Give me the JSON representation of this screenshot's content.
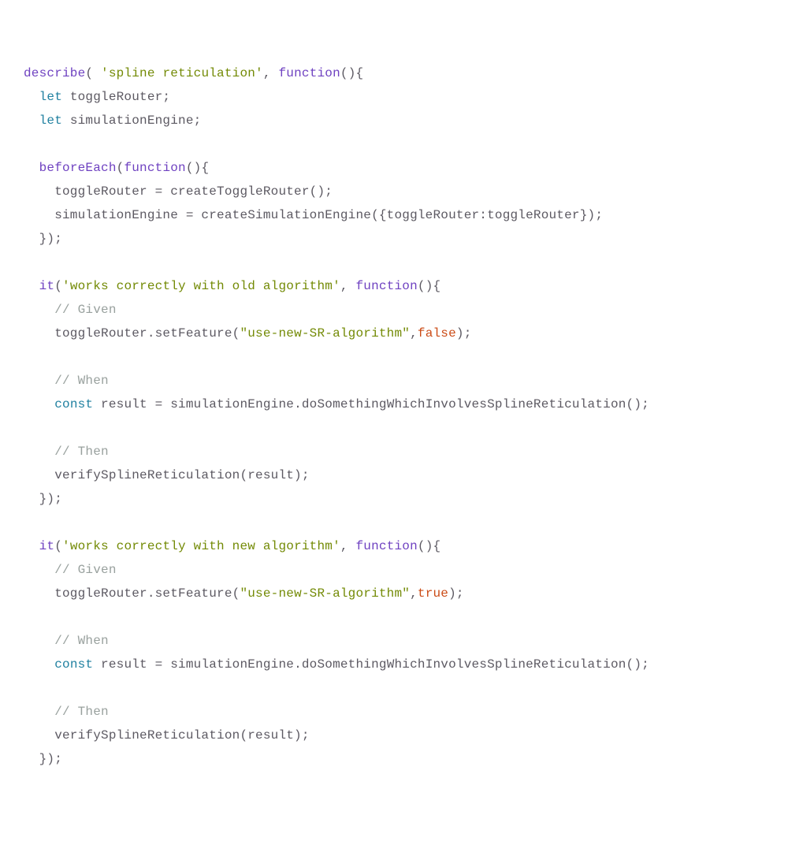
{
  "tokens": [
    {
      "id": "l1t1",
      "cls": "fn"
    },
    {
      "id": "l1t2",
      "cls": "id"
    },
    {
      "id": "l1t3",
      "cls": "str"
    },
    {
      "id": "l1t4",
      "cls": "id"
    },
    {
      "id": "l1t5",
      "cls": "fn"
    },
    {
      "id": "l1t6",
      "cls": "id"
    },
    {
      "id": "l2t1",
      "cls": "id"
    },
    {
      "id": "l2t2",
      "cls": "kw"
    },
    {
      "id": "l2t3",
      "cls": "id"
    },
    {
      "id": "l3t1",
      "cls": "id"
    },
    {
      "id": "l3t2",
      "cls": "kw"
    },
    {
      "id": "l3t3",
      "cls": "id"
    },
    {
      "id": "l4",
      "cls": "id"
    },
    {
      "id": "l5t1",
      "cls": "id"
    },
    {
      "id": "l5t2",
      "cls": "fn"
    },
    {
      "id": "l5t3",
      "cls": "id"
    },
    {
      "id": "l5t4",
      "cls": "fn"
    },
    {
      "id": "l5t5",
      "cls": "id"
    },
    {
      "id": "l6",
      "cls": "id"
    },
    {
      "id": "l7",
      "cls": "id"
    },
    {
      "id": "l8",
      "cls": "id"
    },
    {
      "id": "l9",
      "cls": "id"
    },
    {
      "id": "l10t1",
      "cls": "id"
    },
    {
      "id": "l10t2",
      "cls": "fn"
    },
    {
      "id": "l10t3",
      "cls": "id"
    },
    {
      "id": "l10t4",
      "cls": "str"
    },
    {
      "id": "l10t5",
      "cls": "id"
    },
    {
      "id": "l10t6",
      "cls": "fn"
    },
    {
      "id": "l10t7",
      "cls": "id"
    },
    {
      "id": "l11t1",
      "cls": "id"
    },
    {
      "id": "l11t2",
      "cls": "com"
    },
    {
      "id": "l12t1",
      "cls": "id"
    },
    {
      "id": "l12t2",
      "cls": "str"
    },
    {
      "id": "l12t3",
      "cls": "id"
    },
    {
      "id": "l12t4",
      "cls": "lit"
    },
    {
      "id": "l12t5",
      "cls": "id"
    },
    {
      "id": "l13",
      "cls": "id"
    },
    {
      "id": "l14t1",
      "cls": "id"
    },
    {
      "id": "l14t2",
      "cls": "com"
    },
    {
      "id": "l15t1",
      "cls": "id"
    },
    {
      "id": "l15t2",
      "cls": "kw"
    },
    {
      "id": "l15t3",
      "cls": "id"
    },
    {
      "id": "l16",
      "cls": "id"
    },
    {
      "id": "l17t1",
      "cls": "id"
    },
    {
      "id": "l17t2",
      "cls": "com"
    },
    {
      "id": "l18",
      "cls": "id"
    },
    {
      "id": "l19",
      "cls": "id"
    },
    {
      "id": "l20",
      "cls": "id"
    },
    {
      "id": "l21t1",
      "cls": "id"
    },
    {
      "id": "l21t2",
      "cls": "fn"
    },
    {
      "id": "l21t3",
      "cls": "id"
    },
    {
      "id": "l21t4",
      "cls": "str"
    },
    {
      "id": "l21t5",
      "cls": "id"
    },
    {
      "id": "l21t6",
      "cls": "fn"
    },
    {
      "id": "l21t7",
      "cls": "id"
    },
    {
      "id": "l22t1",
      "cls": "id"
    },
    {
      "id": "l22t2",
      "cls": "com"
    },
    {
      "id": "l23t1",
      "cls": "id"
    },
    {
      "id": "l23t2",
      "cls": "str"
    },
    {
      "id": "l23t3",
      "cls": "id"
    },
    {
      "id": "l23t4",
      "cls": "lit"
    },
    {
      "id": "l23t5",
      "cls": "id"
    },
    {
      "id": "l24",
      "cls": "id"
    },
    {
      "id": "l25t1",
      "cls": "id"
    },
    {
      "id": "l25t2",
      "cls": "com"
    },
    {
      "id": "l26t1",
      "cls": "id"
    },
    {
      "id": "l26t2",
      "cls": "kw"
    },
    {
      "id": "l26t3",
      "cls": "id"
    },
    {
      "id": "l27",
      "cls": "id"
    },
    {
      "id": "l28t1",
      "cls": "id"
    },
    {
      "id": "l28t2",
      "cls": "com"
    },
    {
      "id": "l29",
      "cls": "id"
    },
    {
      "id": "l30",
      "cls": "id"
    }
  ],
  "text": {
    "l1t1": "describe",
    "l1t2": "( ",
    "l1t3": "'spline reticulation'",
    "l1t4": ", ",
    "l1t5": "function",
    "l1t6": "(){",
    "l2t1": "  ",
    "l2t2": "let",
    "l2t3": " toggleRouter;",
    "l3t1": "  ",
    "l3t2": "let",
    "l3t3": " simulationEngine;",
    "l4": "",
    "l5t1": "  ",
    "l5t2": "beforeEach",
    "l5t3": "(",
    "l5t4": "function",
    "l5t5": "(){",
    "l6": "    toggleRouter = createToggleRouter();",
    "l7": "    simulationEngine = createSimulationEngine({toggleRouter:toggleRouter});",
    "l8": "  });",
    "l9": "",
    "l10t1": "  ",
    "l10t2": "it",
    "l10t3": "(",
    "l10t4": "'works correctly with old algorithm'",
    "l10t5": ", ",
    "l10t6": "function",
    "l10t7": "(){",
    "l11t1": "    ",
    "l11t2": "// Given",
    "l12t1": "    toggleRouter.setFeature(",
    "l12t2": "\"use-new-SR-algorithm\"",
    "l12t3": ",",
    "l12t4": "false",
    "l12t5": ");",
    "l13": "",
    "l14t1": "    ",
    "l14t2": "// When",
    "l15t1": "    ",
    "l15t2": "const",
    "l15t3": " result = simulationEngine.doSomethingWhichInvolvesSplineReticulation();",
    "l16": "",
    "l17t1": "    ",
    "l17t2": "// Then",
    "l18": "    verifySplineReticulation(result);",
    "l19": "  });",
    "l20": "",
    "l21t1": "  ",
    "l21t2": "it",
    "l21t3": "(",
    "l21t4": "'works correctly with new algorithm'",
    "l21t5": ", ",
    "l21t6": "function",
    "l21t7": "(){",
    "l22t1": "    ",
    "l22t2": "// Given",
    "l23t1": "    toggleRouter.setFeature(",
    "l23t2": "\"use-new-SR-algorithm\"",
    "l23t3": ",",
    "l23t4": "true",
    "l23t5": ");",
    "l24": "",
    "l25t1": "    ",
    "l25t2": "// When",
    "l26t1": "    ",
    "l26t2": "const",
    "l26t3": " result = simulationEngine.doSomethingWhichInvolvesSplineReticulation();",
    "l27": "",
    "l28t1": "    ",
    "l28t2": "// Then",
    "l29": "    verifySplineReticulation(result);",
    "l30": "  });"
  }
}
